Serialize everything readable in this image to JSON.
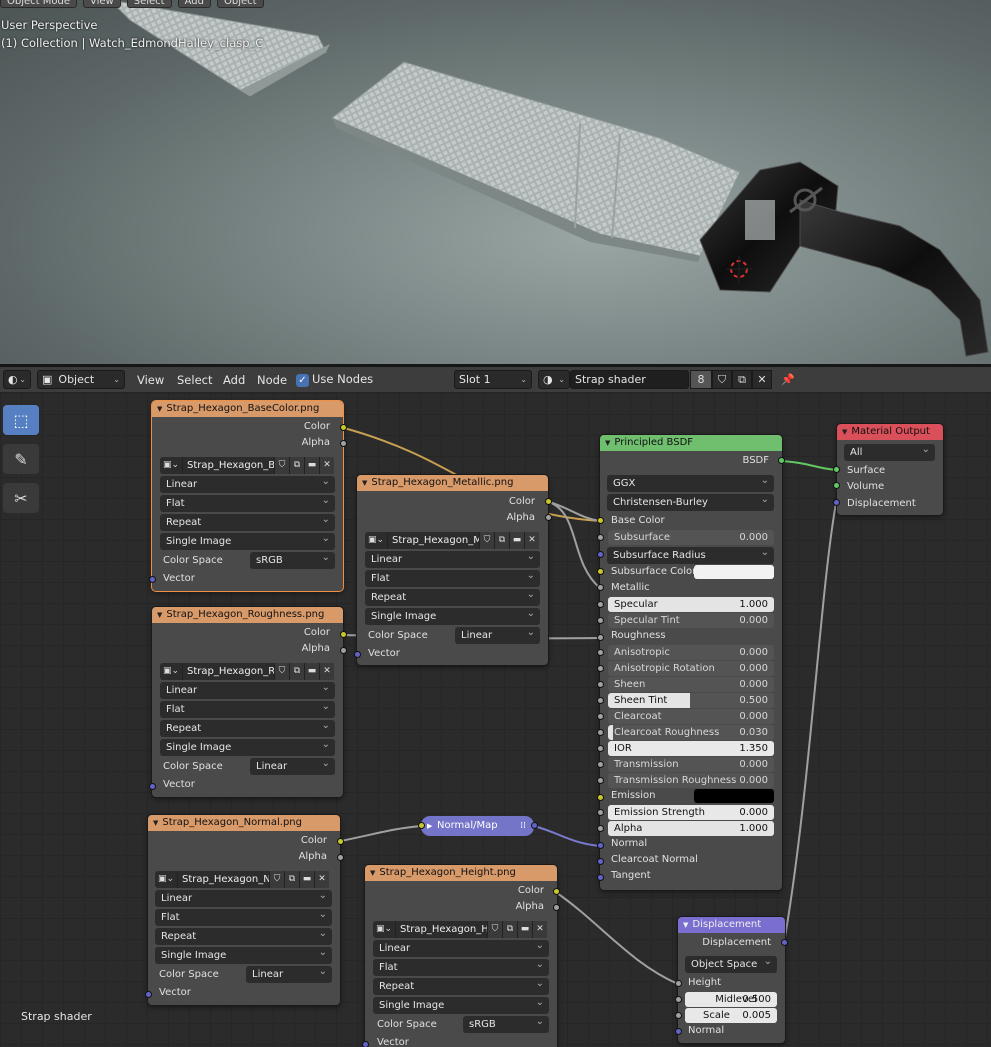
{
  "viewport": {
    "header_items": [
      "Object Mode",
      "View",
      "Select",
      "Add",
      "Object"
    ],
    "perspective": "User Perspective",
    "collection": "(1) Collection | Watch_EdmondHalley_clasp_C"
  },
  "editor": {
    "object_mode": "Object",
    "menus": {
      "view": "View",
      "select": "Select",
      "add": "Add",
      "node": "Node"
    },
    "use_nodes": "Use Nodes",
    "slot": "Slot 1",
    "material": "Strap shader",
    "user_count": "8",
    "footer_label": "Strap shader"
  },
  "common": {
    "color": "Color",
    "alpha": "Alpha",
    "vector": "Vector",
    "color_space": "Color Space",
    "linear": "Linear",
    "flat": "Flat",
    "repeat": "Repeat",
    "single_image": "Single Image",
    "srgb": "sRGB"
  },
  "nodes": {
    "base_color": {
      "title": "Strap_Hexagon_BaseColor.png",
      "image": "Strap_Hexagon_Ba..."
    },
    "roughness": {
      "title": "Strap_Hexagon_Roughness.png",
      "image": "Strap_Hexagon_Ro..."
    },
    "metallic": {
      "title": "Strap_Hexagon_Metallic.png",
      "image": "Strap_Hexagon_M..."
    },
    "normal": {
      "title": "Strap_Hexagon_Normal.png",
      "image": "Strap_Hexagon_No..."
    },
    "height": {
      "title": "Strap_Hexagon_Height.png",
      "image": "Strap_Hexagon_He..."
    },
    "normal_map": {
      "title": "Normal/Map"
    },
    "bsdf": {
      "title": "Principled BSDF",
      "output": "BSDF",
      "distribution": "GGX",
      "subsurface_method": "Christensen-Burley",
      "base_color": "Base Color",
      "subsurface": {
        "label": "Subsurface",
        "value": "0.000"
      },
      "subsurface_radius": "Subsurface Radius",
      "subsurface_color": "Subsurface Color",
      "metallic": "Metallic",
      "specular": {
        "label": "Specular",
        "value": "1.000"
      },
      "specular_tint": {
        "label": "Specular Tint",
        "value": "0.000"
      },
      "roughness": "Roughness",
      "anisotropic": {
        "label": "Anisotropic",
        "value": "0.000"
      },
      "anisotropic_rotation": {
        "label": "Anisotropic Rotation",
        "value": "0.000"
      },
      "sheen": {
        "label": "Sheen",
        "value": "0.000"
      },
      "sheen_tint": {
        "label": "Sheen Tint",
        "value": "0.500"
      },
      "clearcoat": {
        "label": "Clearcoat",
        "value": "0.000"
      },
      "clearcoat_roughness": {
        "label": "Clearcoat Roughness",
        "value": "0.030"
      },
      "ior": {
        "label": "IOR",
        "value": "1.350"
      },
      "transmission": {
        "label": "Transmission",
        "value": "0.000"
      },
      "transmission_roughness": {
        "label": "Transmission Roughness",
        "value": "0.000"
      },
      "emission": "Emission",
      "emission_strength": {
        "label": "Emission Strength",
        "value": "0.000"
      },
      "alpha": {
        "label": "Alpha",
        "value": "1.000"
      },
      "normal": "Normal",
      "clearcoat_normal": "Clearcoat Normal",
      "tangent": "Tangent"
    },
    "output": {
      "title": "Material Output",
      "target": "All",
      "surface": "Surface",
      "volume": "Volume",
      "displacement": "Displacement"
    },
    "displacement": {
      "title": "Displacement",
      "output": "Displacement",
      "space": "Object Space",
      "height": "Height",
      "midlevel": {
        "label": "Midlevel",
        "value": "0.500"
      },
      "scale": {
        "label": "Scale",
        "value": "0.005"
      },
      "normal": "Normal"
    }
  },
  "colors": {
    "texture_header": "#d99a6a",
    "bsdf_header": "#6fbf6f",
    "output_header": "#d9505a",
    "vector_header": "#7a6fd0",
    "socket_color": "#c7c729",
    "socket_float": "#a1a1a1",
    "socket_vector": "#6363c7",
    "socket_shader": "#63c763",
    "selection": "#ed8f44"
  }
}
